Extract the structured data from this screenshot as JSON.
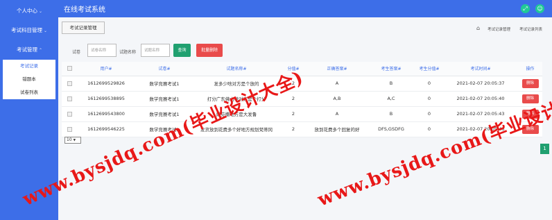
{
  "sidebar": {
    "personal_center": "个人中心",
    "subject_mgmt": "考试科目管理",
    "exam_mgmt": "考试管理",
    "submenu": [
      "考试记录",
      "错题本",
      "试卷列表"
    ]
  },
  "header": {
    "title": "在线考试系统"
  },
  "page": {
    "title_button": "考试记录管理",
    "breadcrumb": [
      "考试记录管理",
      "考试记录列表"
    ]
  },
  "filters": {
    "paper_label": "试卷",
    "paper_placeholder": "试卷名称",
    "question_label": "试题名称",
    "question_placeholder": "试题名称",
    "search_button": "查询",
    "batch_delete_button": "批量删除"
  },
  "table": {
    "columns": [
      "用户#",
      "试卷#",
      "试题名称#",
      "分值#",
      "正确答案#",
      "考生答案#",
      "考生分值#",
      "考试时间#",
      "操作"
    ],
    "rows": [
      {
        "user": "1612699529826",
        "paper": "数学竞赛考试1",
        "question": "发多少啥对方是个放的",
        "score": "2",
        "answer": "A",
        "student_answer": "B",
        "student_score": "0",
        "time": "2021-02-07 20:05:37",
        "action": "删除"
      },
      {
        "user": "1612699538895",
        "paper": "数学竞赛考试1",
        "question": "打分广东佛山啥对方是个打分",
        "score": "2",
        "answer": "A,B",
        "student_answer": "A,C",
        "student_score": "0",
        "time": "2021-02-07 20:05:40",
        "action": "删除"
      },
      {
        "user": "1612699543800",
        "paper": "数学竞赛考试1",
        "question": "萨芬撒地方是大发鲁",
        "score": "2",
        "answer": "A",
        "student_answer": "B",
        "student_score": "0",
        "time": "2021-02-07 20:05:43",
        "action": "删除"
      },
      {
        "user": "1612699546225",
        "paper": "数学竞赛考试1",
        "question": "发货放到花费多个好地方规划梵蒂冈",
        "score": "2",
        "answer": "放到花费多个回复的好",
        "student_answer": "DFS,GSDFG",
        "student_score": "0",
        "time": "2021-02-07 20:05:46",
        "action": "删除"
      }
    ]
  },
  "pagination": {
    "per_page": "10",
    "current_page": "1"
  },
  "watermark": "www.bysjdq.com(毕业设计大全)",
  "colors": {
    "primary": "#3d6ee8",
    "danger": "#e94b4b",
    "success": "#20a070",
    "watermark": "#e81818"
  },
  "icons": [
    "chevron-down-icon",
    "expand-icon",
    "user-icon",
    "home-icon"
  ]
}
